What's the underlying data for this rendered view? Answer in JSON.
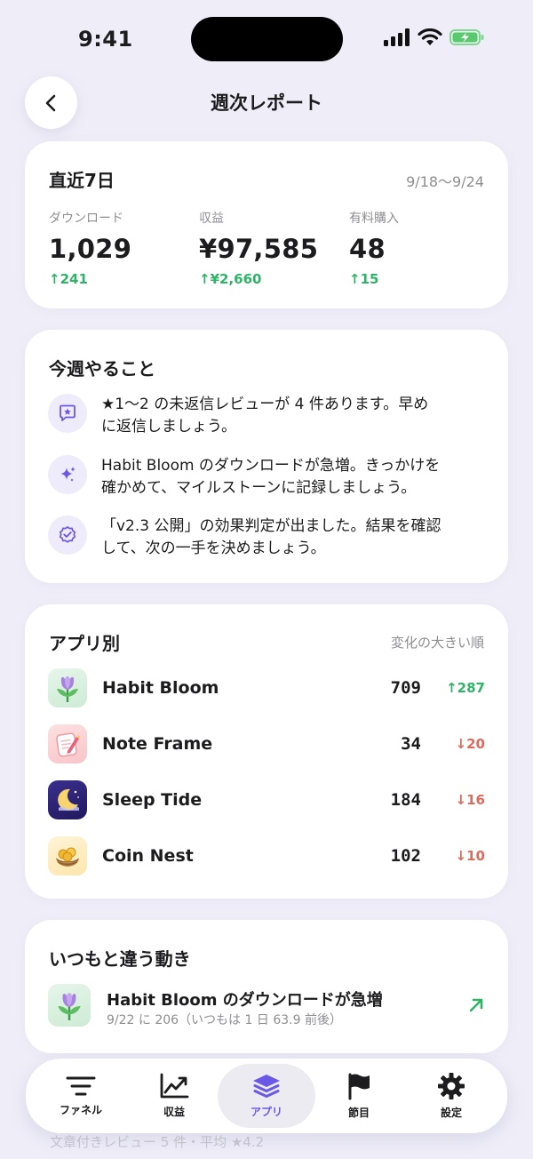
{
  "status_bar": {
    "time": "9:41"
  },
  "header": {
    "title": "週次レポート"
  },
  "summary": {
    "title": "直近7日",
    "range": "9/18〜9/24",
    "metrics": [
      {
        "label": "ダウンロード",
        "value": "1,029",
        "delta": "↑241"
      },
      {
        "label": "収益",
        "value": "¥97,585",
        "delta": "↑¥2,660"
      },
      {
        "label": "有料購入",
        "value": "48",
        "delta": "↑15"
      }
    ]
  },
  "todo": {
    "title": "今週やること",
    "items": [
      {
        "icon": "star-message-icon",
        "line1": "★1〜2 の未返信レビューが 4 件あります。早め",
        "line2": "に返信しましょう。"
      },
      {
        "icon": "sparkle-icon",
        "line1": "Habit Bloom のダウンロードが急増。きっかけを",
        "line2": "確かめて、マイルストーンに記録しましょう。"
      },
      {
        "icon": "verified-badge-icon",
        "line1": "「v2.3 公開」の効果判定が出ました。結果を確認",
        "line2": "して、次の一手を決めましょう。"
      }
    ]
  },
  "apps": {
    "title": "アプリ別",
    "sort": "変化の大きい順",
    "rows": [
      {
        "icon": "tulip-icon",
        "name": "Habit Bloom",
        "count": "709",
        "delta": "↑287",
        "direction": "up"
      },
      {
        "icon": "notepad-icon",
        "name": "Note Frame",
        "count": "34",
        "delta": "↓20",
        "direction": "down"
      },
      {
        "icon": "moon-icon",
        "name": "Sleep Tide",
        "count": "184",
        "delta": "↓16",
        "direction": "down"
      },
      {
        "icon": "coin-nest-icon",
        "name": "Coin Nest",
        "count": "102",
        "delta": "↓10",
        "direction": "down"
      }
    ]
  },
  "unusual": {
    "title": "いつもと違う動き",
    "item_title": "Habit Bloom のダウンロードが急増",
    "item_sub": "9/22 に 206（いつもは 1 日 63.9 前後）"
  },
  "peek_text": "文章付きレビュー 5 件・平均 ★4.2",
  "tabs": [
    {
      "label": "ファネル",
      "icon": "funnel-icon"
    },
    {
      "label": "収益",
      "icon": "chart-up-icon"
    },
    {
      "label": "アプリ",
      "icon": "layers-icon",
      "active": true
    },
    {
      "label": "節目",
      "icon": "flag-icon"
    },
    {
      "label": "設定",
      "icon": "gear-icon"
    }
  ],
  "colors": {
    "accent": "#6b58e6",
    "up": "#2fb467",
    "down": "#e06a5c",
    "background": "#efeef8"
  }
}
